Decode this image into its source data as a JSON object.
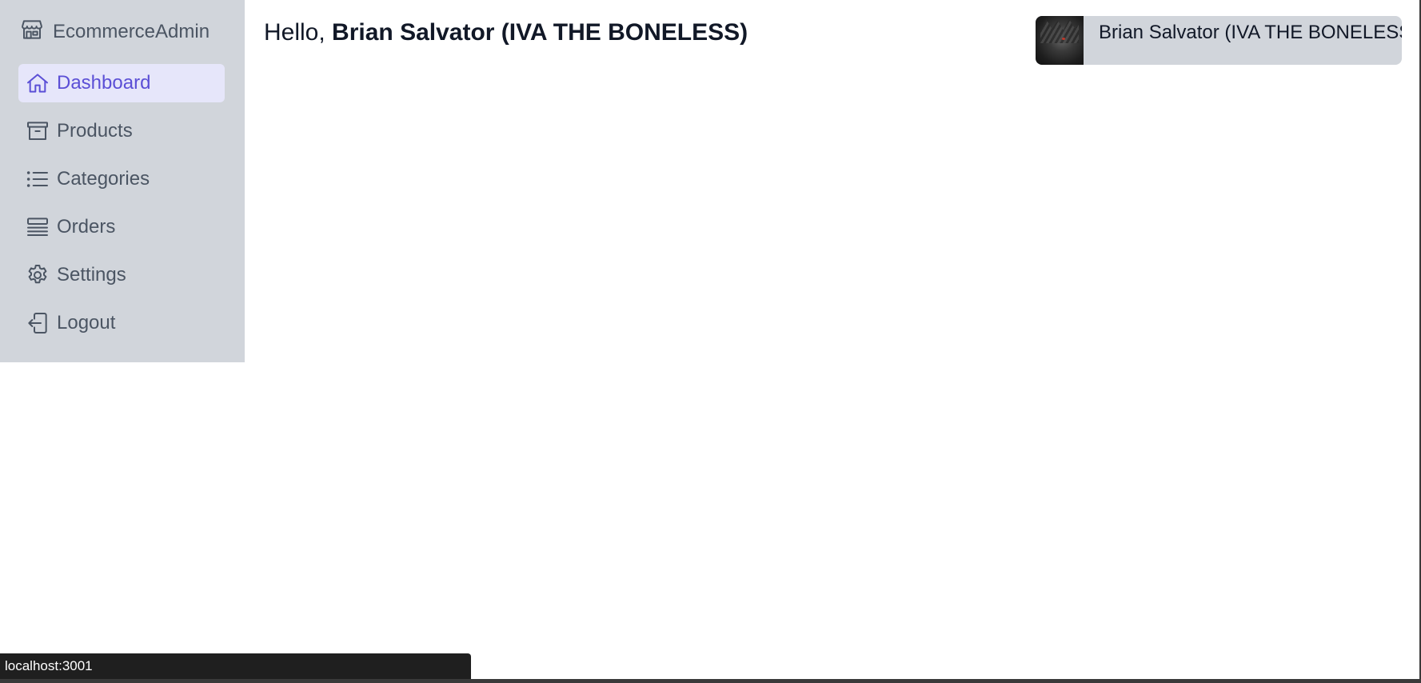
{
  "app": {
    "logo_text": "EcommerceAdmin",
    "logo_icon": "storefront-icon"
  },
  "sidebar": {
    "items": [
      {
        "label": "Dashboard",
        "icon": "home-icon",
        "active": true
      },
      {
        "label": "Products",
        "icon": "archive-box-icon",
        "active": false
      },
      {
        "label": "Categories",
        "icon": "list-bullet-icon",
        "active": false
      },
      {
        "label": "Orders",
        "icon": "queue-list-icon",
        "active": false
      },
      {
        "label": "Settings",
        "icon": "gear-icon",
        "active": false
      },
      {
        "label": "Logout",
        "icon": "logout-icon",
        "active": false
      }
    ]
  },
  "header": {
    "greeting_prefix": "Hello, ",
    "greeting_name": "Brian Salvator (IVA THE BONELESS)",
    "user_chip_name": "Brian Salvator (IVA THE BONELESS)"
  },
  "status_bar": {
    "url": "localhost:3001"
  },
  "colors": {
    "sidebar_bg": "#d1d5db",
    "active_bg": "#e6e6fa",
    "accent": "#5b4fd6",
    "text": "#4b5563"
  }
}
